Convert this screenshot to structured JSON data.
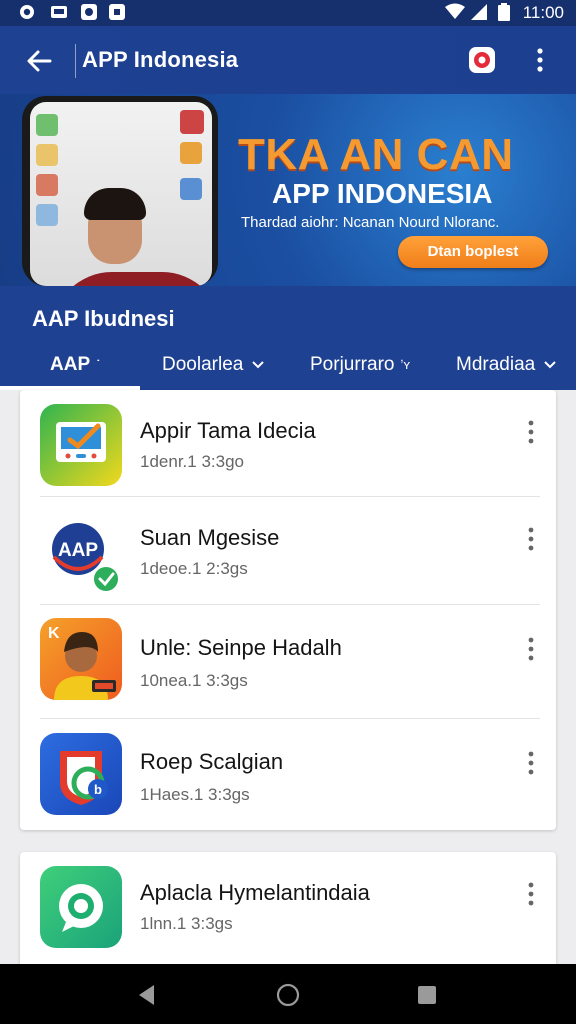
{
  "status_bar": {
    "time": "11:00",
    "left_icons": [
      "notification-icon",
      "news-icon",
      "app-icon",
      "app-icon-2"
    ],
    "right_icons": [
      "wifi-icon",
      "signal-icon",
      "battery-icon"
    ]
  },
  "app_bar": {
    "title": "APP Indonesia",
    "back_icon": "arrow-left-icon",
    "app_icon": "app-badge-icon",
    "more_icon": "more-vertical-icon"
  },
  "banner": {
    "headline": "TKA AN CAN",
    "subhead": "APP INDONESIA",
    "tagline": "Thardad aiohr: Ncanan Nourd Nloranc.",
    "cta_label": "Dtan boplest",
    "colors": {
      "headline": "#f59a30",
      "cta": "#f58a22"
    }
  },
  "section": {
    "title": "AAP Ibudnesi",
    "tabs": [
      {
        "label": "AAP",
        "chevron": "˙",
        "active": true
      },
      {
        "label": "Doolarlea",
        "chevron": "⌄",
        "active": false
      },
      {
        "label": "Porjurraro",
        "chevron": "ʼʏ",
        "active": false
      },
      {
        "label": "Mdradiaa",
        "chevron": "⌄",
        "active": false
      }
    ]
  },
  "apps": [
    {
      "name": "Appir Tama Idecia",
      "meta": "1denr.1 3:3go",
      "icon": "screen-check-app-icon"
    },
    {
      "name": "Suan Mgesise",
      "meta": "1deoe.1 2:3gs",
      "icon": "aap-logo-check-icon"
    },
    {
      "name": "Unle: Seinpe Hadalh",
      "meta": "10nea.1 3:3gs",
      "icon": "avatar-app-icon"
    },
    {
      "name": "Roep Scalgian",
      "meta": "1Haes.1 3:3gs",
      "icon": "shield-swirl-app-icon"
    },
    {
      "name": "Aplacla Hymelantindaia",
      "meta": "1lnn.1 3:3gs",
      "icon": "chat-bubble-app-icon"
    }
  ],
  "colors": {
    "app_bar": "#1e4192",
    "status_bar": "#16306e",
    "background": "#ededf0"
  },
  "nav_bar": {
    "icons": [
      "back-triangle-icon",
      "home-circle-icon",
      "recents-square-icon"
    ]
  }
}
